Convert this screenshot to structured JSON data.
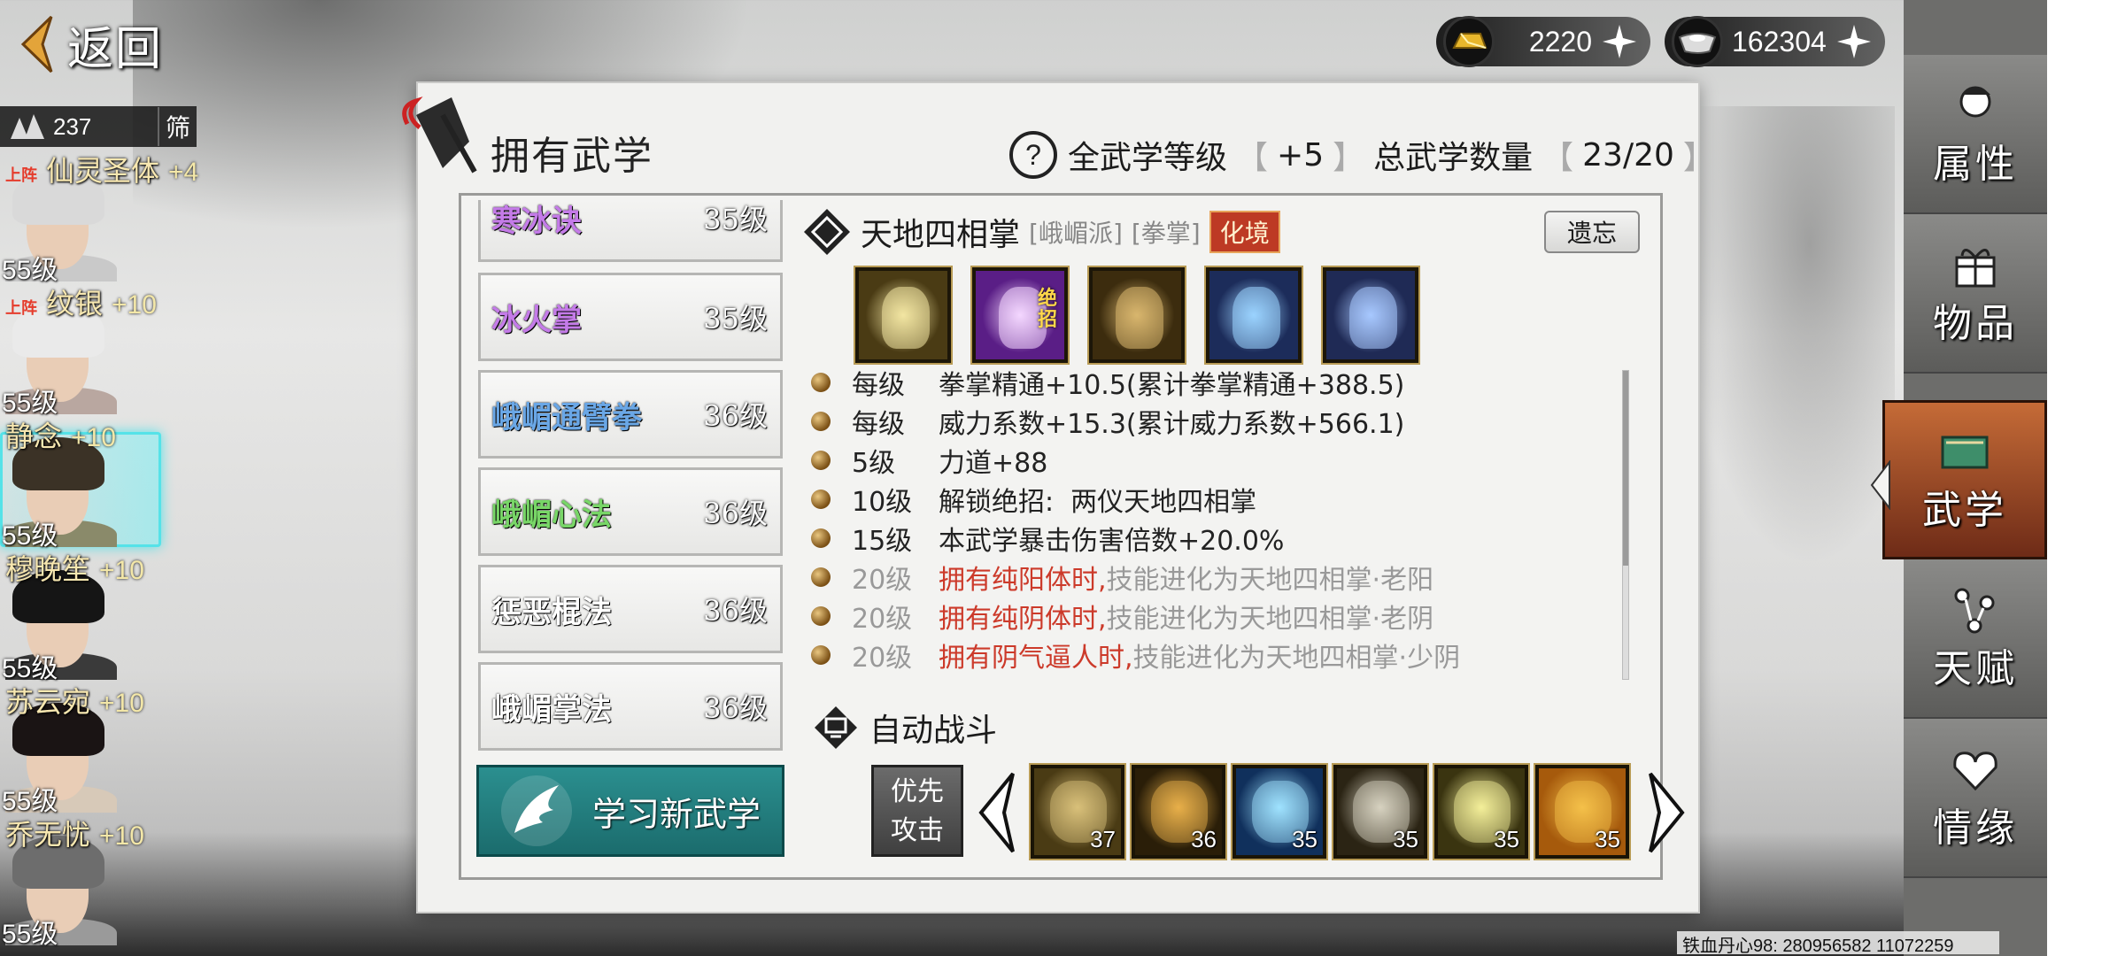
{
  "top": {
    "back_label": "返回",
    "gold": "2220",
    "silver": "162304"
  },
  "roster": {
    "count": "237",
    "filter_label": "筛",
    "onduty_label": "上阵",
    "characters": [
      {
        "name": "仙灵圣体",
        "bonus": "+4",
        "level": "55级",
        "on_duty": true,
        "hair": "#d9d9d9",
        "body": "#c9c9c9"
      },
      {
        "name": "纹银",
        "bonus": "+10",
        "level": "55级",
        "on_duty": true,
        "hair": "#eaeaea",
        "body": "#b9a7a0"
      },
      {
        "name": "静念",
        "bonus": "+10",
        "level": "55级",
        "on_duty": false,
        "hair": "#3b3226",
        "body": "#8a8a6a"
      },
      {
        "name": "穆晚笙",
        "bonus": "+10",
        "level": "55级",
        "on_duty": false,
        "hair": "#151515",
        "body": "#3a3a3a"
      },
      {
        "name": "苏云宛",
        "bonus": "+10",
        "level": "55级",
        "on_duty": false,
        "hair": "#1a1414",
        "body": "#d7c9b8"
      },
      {
        "name": "乔无忧",
        "bonus": "+10",
        "level": "55级",
        "on_duty": false,
        "hair": "#6d6d6d",
        "body": "#9a9a9a"
      }
    ]
  },
  "panel": {
    "title": "拥有武学",
    "all_level_label": "全武学等级",
    "all_level_value": "+5",
    "total_label": "总武学数量",
    "total_value": "23/20",
    "learn_label": "学习新武学"
  },
  "skills": [
    {
      "name": "寒冰诀",
      "level": "35级",
      "color": "#c47be8"
    },
    {
      "name": "冰火掌",
      "level": "35级",
      "color": "#c47be8"
    },
    {
      "name": "峨嵋通臂拳",
      "level": "36级",
      "color": "#6aa7e6"
    },
    {
      "name": "峨嵋心法",
      "level": "36级",
      "color": "#78d667"
    },
    {
      "name": "惩恶棍法",
      "level": "36级",
      "color": "#ffffff"
    },
    {
      "name": "峨嵋掌法",
      "level": "36级",
      "color": "#ffffff"
    }
  ],
  "detail": {
    "title": "天地四相掌",
    "sect": "[峨嵋派]",
    "type": "[拳掌]",
    "realm": "化境",
    "forget_label": "遗忘",
    "ult_label": "绝招",
    "icons": [
      {
        "bg": "#4a3b14",
        "glow": "#f3e6a2"
      },
      {
        "bg": "#5a1e86",
        "glow": "#f4d7ff"
      },
      {
        "bg": "#3c2c0e",
        "glow": "#d9b66e"
      },
      {
        "bg": "#1c2c5a",
        "glow": "#9bd3ff"
      },
      {
        "bg": "#1f2a55",
        "glow": "#a7c8ff"
      }
    ],
    "effects": [
      {
        "level": "每级",
        "text": "拳掌精通+10.5(累计拳掌精通+388.5)",
        "red": "",
        "dim": false
      },
      {
        "level": "每级",
        "text": "威力系数+15.3(累计威力系数+566.1)",
        "red": "",
        "dim": false
      },
      {
        "level": "5级",
        "text": "力道+88",
        "red": "",
        "dim": false
      },
      {
        "level": "10级",
        "text": "解锁绝招:  两仪天地四相掌",
        "red": "",
        "dim": false
      },
      {
        "level": "15级",
        "text": "本武学暴击伤害倍数+20.0%",
        "red": "",
        "dim": false
      },
      {
        "level": "20级",
        "text": "技能进化为天地四相掌·老阳",
        "red": "拥有纯阳体时,",
        "dim": true
      },
      {
        "level": "20级",
        "text": "技能进化为天地四相掌·老阴",
        "red": "拥有纯阴体时,",
        "dim": true
      },
      {
        "level": "20级",
        "text": "技能进化为天地四相掌·少阴",
        "red": "拥有阴气逼人时,",
        "dim": true
      }
    ]
  },
  "auto_battle": {
    "label": "自动战斗",
    "priority_line1": "优先",
    "priority_line2": "攻击",
    "skills": [
      {
        "level": "37",
        "bg": "#4a3b14",
        "art": "#d9c07a"
      },
      {
        "level": "36",
        "bg": "#2a1e08",
        "art": "#e8b04a"
      },
      {
        "level": "35",
        "bg": "#10305c",
        "art": "#9fe3ff"
      },
      {
        "level": "35",
        "bg": "#2b2414",
        "art": "#d7d2c0"
      },
      {
        "level": "35",
        "bg": "#3a3410",
        "art": "#f4ef9a"
      },
      {
        "level": "35",
        "bg": "#a65a0c",
        "art": "#f5c04a"
      }
    ]
  },
  "menu": [
    {
      "label": "属性",
      "icon": "person-head-icon",
      "active": false
    },
    {
      "label": "物品",
      "icon": "gift-box-icon",
      "active": false
    },
    {
      "label": "武学",
      "icon": "book-scroll-icon",
      "active": true
    },
    {
      "label": "天赋",
      "icon": "talent-nodes-icon",
      "active": false
    },
    {
      "label": "情缘",
      "icon": "heart-knot-icon",
      "active": false
    }
  ],
  "watermark": "铁血丹心98: 280956582  11072259"
}
